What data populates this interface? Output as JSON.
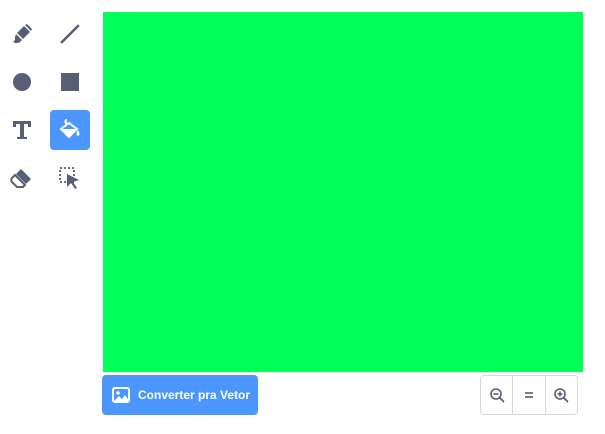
{
  "toolbar": {
    "tools": [
      {
        "name": "brush",
        "icon": "brush-icon",
        "active": false
      },
      {
        "name": "line",
        "icon": "line-icon",
        "active": false
      },
      {
        "name": "circle",
        "icon": "circle-icon",
        "active": false
      },
      {
        "name": "rectangle",
        "icon": "rectangle-icon",
        "active": false
      },
      {
        "name": "text",
        "icon": "text-icon",
        "active": false
      },
      {
        "name": "fill",
        "icon": "fill-bucket-icon",
        "active": true
      },
      {
        "name": "eraser",
        "icon": "eraser-icon",
        "active": false
      },
      {
        "name": "select",
        "icon": "select-icon",
        "active": false
      }
    ]
  },
  "canvas": {
    "fill_color": "#00ff57"
  },
  "convert_button": {
    "label": "Converter pra Vetor",
    "icon": "image-icon",
    "color": "#4c97ff"
  },
  "zoom": {
    "buttons": [
      {
        "name": "zoom-out",
        "icon": "zoom-out-icon"
      },
      {
        "name": "zoom-reset",
        "icon": "equals-icon"
      },
      {
        "name": "zoom-in",
        "icon": "zoom-in-icon"
      }
    ]
  },
  "colors": {
    "icon": "#575e75",
    "icon_active": "#ffffff",
    "accent": "#4c97ff"
  }
}
